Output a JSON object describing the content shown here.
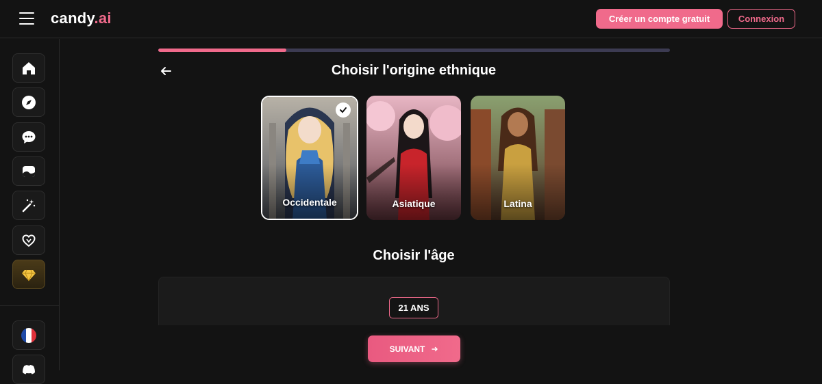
{
  "header": {
    "logo_main": "candy",
    "logo_accent": ".ai",
    "signup_label": "Créer un compte gratuit",
    "login_label": "Connexion"
  },
  "progress": {
    "fraction": 0.25
  },
  "page": {
    "title": "Choisir l'origine ethnique",
    "age_title": "Choisir l'âge",
    "age_value": "21 ANS",
    "next_label": "SUIVANT"
  },
  "ethnicities": [
    {
      "label": "Occidentale",
      "selected": true
    },
    {
      "label": "Asiatique",
      "selected": false
    },
    {
      "label": "Latina",
      "selected": false
    }
  ],
  "sidebar": {
    "items": [
      "home-icon",
      "compass-icon",
      "chat-icon",
      "gallery-icon",
      "magic-wand-icon",
      "heart-hands-icon",
      "diamond-icon",
      "flag-fr-icon",
      "discord-icon"
    ]
  },
  "colors": {
    "accent": "#f06a8b",
    "background": "#131313",
    "progress_track": "#3c3b52"
  }
}
